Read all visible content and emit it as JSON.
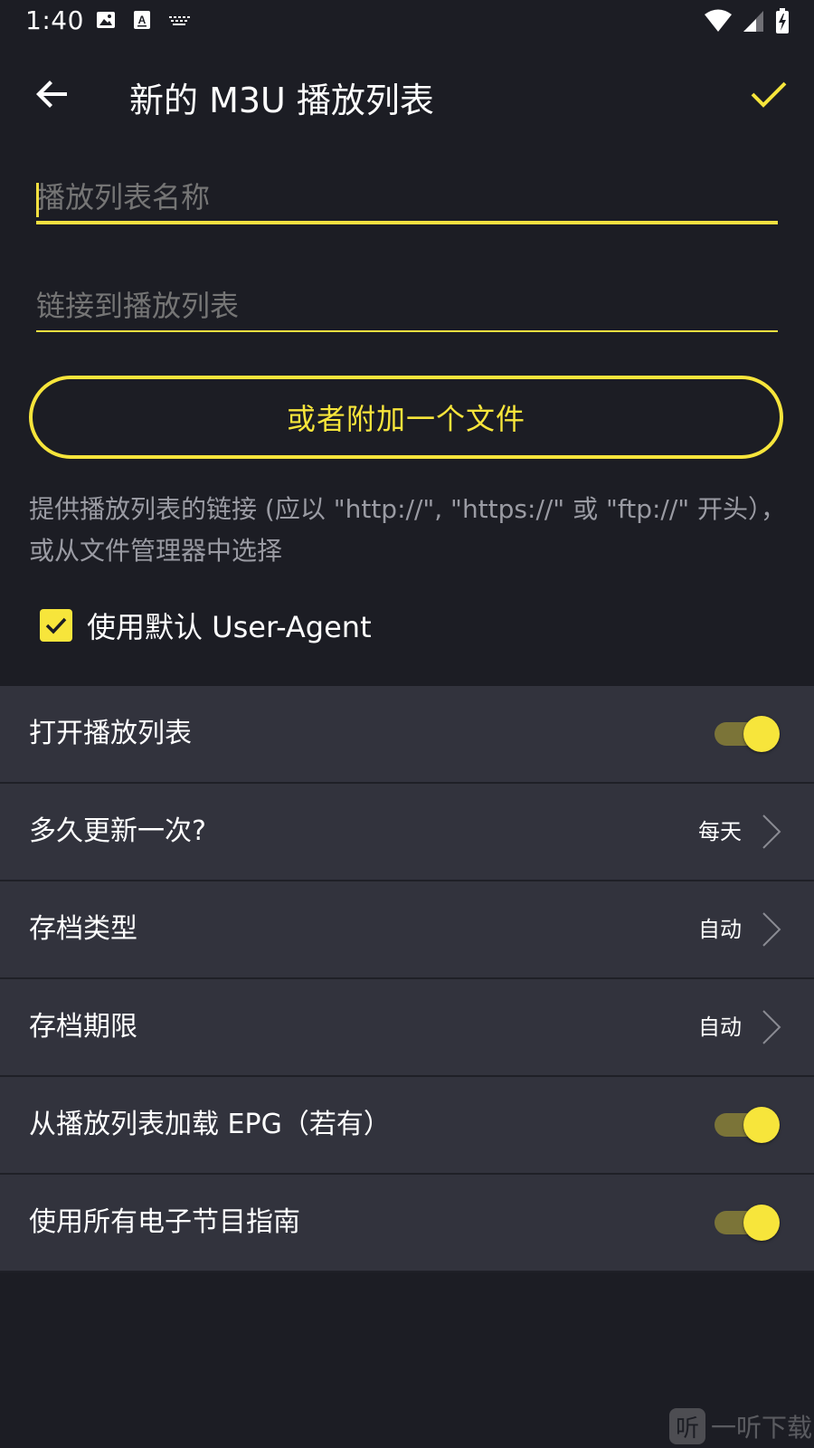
{
  "status_bar": {
    "time": "1:40",
    "left_icons": [
      "image-icon",
      "text-a-icon",
      "keyboard-icon"
    ],
    "right_icons": [
      "wifi-icon",
      "signal-icon",
      "battery-charging-icon"
    ]
  },
  "app_bar": {
    "back_icon": "arrow-left-icon",
    "title": "新的 M3U 播放列表",
    "confirm_icon": "check-icon"
  },
  "form": {
    "playlist_name_placeholder": "播放列表名称",
    "playlist_name_value": "",
    "playlist_url_placeholder": "链接到播放列表",
    "playlist_url_value": "",
    "attach_button_label": "或者附加一个文件",
    "hint": "提供播放列表的链接 (应以 \"http://\", \"https://\" 或 \"ftp://\" 开头），或从文件管理器中选择",
    "use_default_ua_label": "使用默认 User-Agent",
    "use_default_ua_checked": true
  },
  "settings": {
    "open_playlist": {
      "label": "打开播放列表",
      "enabled": true
    },
    "update_frequency": {
      "label": "多久更新一次?",
      "value": "每天"
    },
    "archive_type": {
      "label": "存档类型",
      "value": "自动"
    },
    "archive_period": {
      "label": "存档期限",
      "value": "自动"
    },
    "load_epg": {
      "label": "从播放列表加载 EPG（若有）",
      "enabled": true
    },
    "use_all_epg": {
      "label": "使用所有电子节目指南",
      "enabled": true
    }
  },
  "watermark": {
    "glyph": "听",
    "text": "一听下载"
  },
  "colors": {
    "background": "#1c1d24",
    "row_background": "#32333d",
    "accent": "#f7e53b",
    "hint_text": "#9a9ba3"
  }
}
